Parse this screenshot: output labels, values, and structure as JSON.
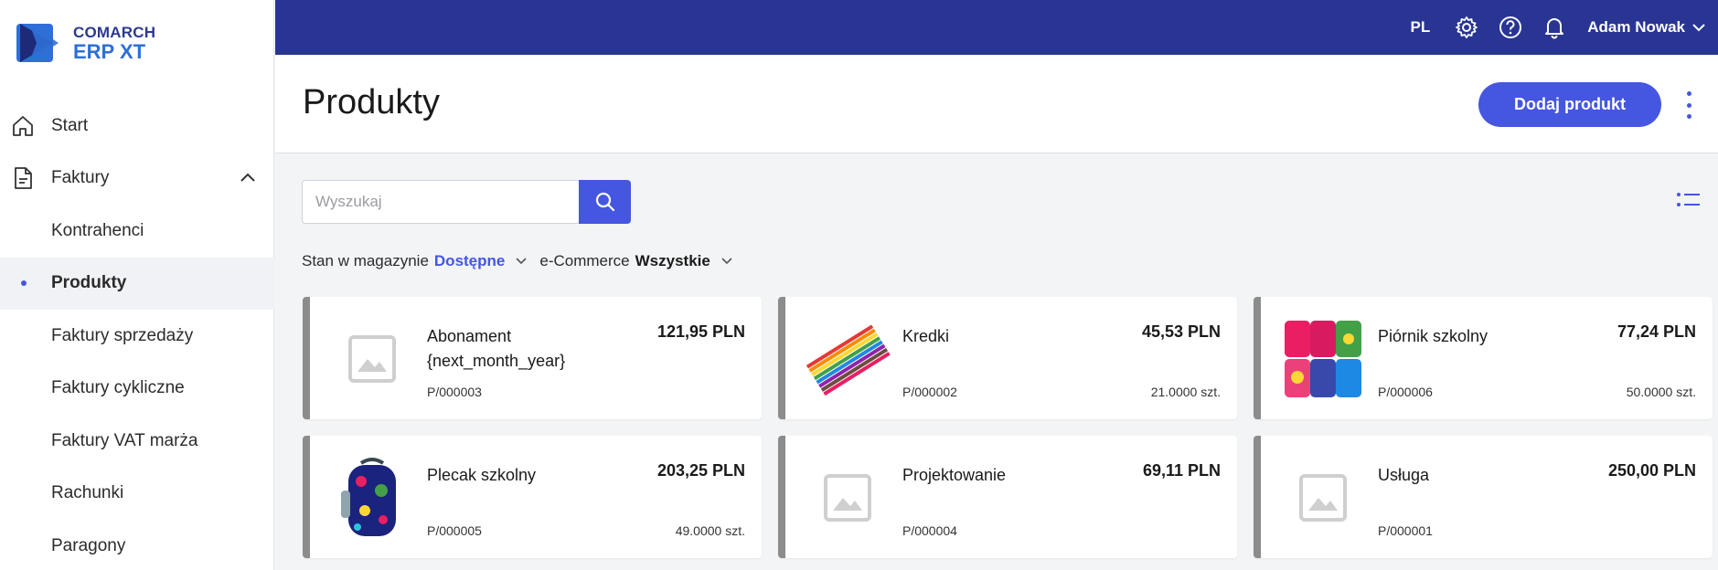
{
  "brand": {
    "line1": "COMARCH",
    "line2": "ERP XT"
  },
  "sidebar": {
    "items": [
      {
        "label": "Start",
        "icon": "home-icon"
      },
      {
        "label": "Faktury",
        "icon": "document-icon"
      },
      {
        "label": "Kontrahenci"
      },
      {
        "label": "Produkty",
        "active": true
      },
      {
        "label": "Faktury sprzedaży"
      },
      {
        "label": "Faktury cykliczne"
      },
      {
        "label": "Faktury VAT marża"
      },
      {
        "label": "Rachunki"
      },
      {
        "label": "Paragony"
      }
    ]
  },
  "topbar": {
    "lang": "PL",
    "user": "Adam Nowak"
  },
  "header": {
    "title": "Produkty",
    "add_button": "Dodaj produkt"
  },
  "search": {
    "placeholder": "Wyszukaj"
  },
  "filters": {
    "stock_label": "Stan w magazynie",
    "stock_value": "Dostępne",
    "ecom_label": "e-Commerce",
    "ecom_value": "Wszystkie"
  },
  "products": [
    {
      "name": "Abonament {next_month_year}",
      "price": "121,95 PLN",
      "code": "P/000003",
      "qty": "",
      "image": "placeholder"
    },
    {
      "name": "Kredki",
      "price": "45,53 PLN",
      "code": "P/000002",
      "qty": "21.0000 szt.",
      "image": "crayons"
    },
    {
      "name": "Piórnik szkolny",
      "price": "77,24 PLN",
      "code": "P/000006",
      "qty": "50.0000 szt.",
      "image": "pencil-cases"
    },
    {
      "name": "Plecak szkolny",
      "price": "203,25 PLN",
      "code": "P/000005",
      "qty": "49.0000 szt.",
      "image": "backpack"
    },
    {
      "name": "Projektowanie",
      "price": "69,11 PLN",
      "code": "P/000004",
      "qty": "",
      "image": "placeholder"
    },
    {
      "name": "Usługa",
      "price": "250,00 PLN",
      "code": "P/000001",
      "qty": "",
      "image": "placeholder"
    }
  ],
  "colors": {
    "topbar": "#283593",
    "accent": "#4556e0",
    "card_border": "#8c8c8c"
  }
}
